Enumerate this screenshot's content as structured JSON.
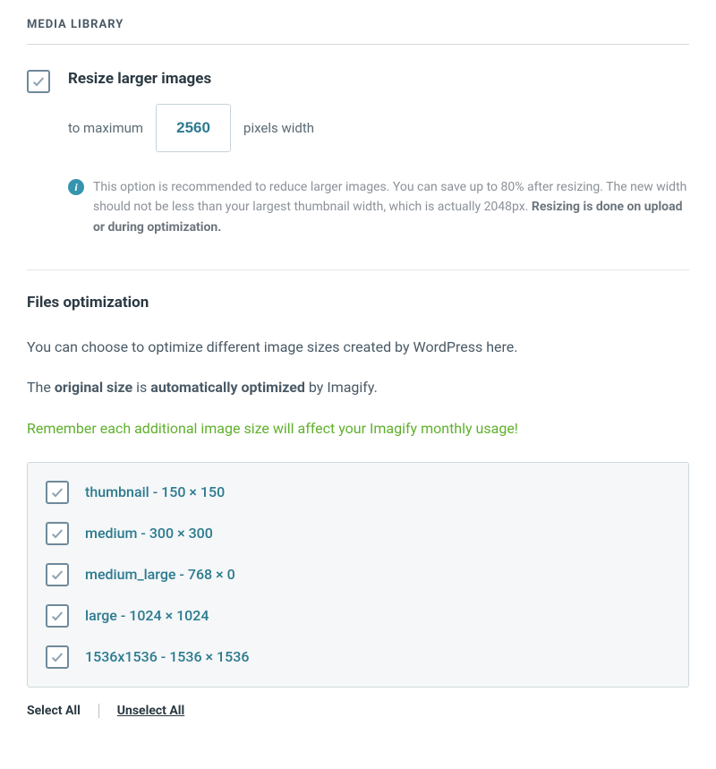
{
  "header": {
    "title": "MEDIA LIBRARY"
  },
  "resize": {
    "title": "Resize larger images",
    "prefix": "to maximum",
    "value": "2560",
    "suffix": "pixels width",
    "info_text_1": "This option is recommended to reduce larger images. You can save up to 80% after resizing. The new width should not be less than your largest thumbnail width, which is actually 2048px. ",
    "info_text_bold": "Resizing is done on upload or during optimization."
  },
  "files_optimization": {
    "title": "Files optimization",
    "line1": "You can choose to optimize different image sizes created by WordPress here.",
    "line2_a": "The ",
    "line2_b": "original size",
    "line2_c": " is ",
    "line2_d": "automatically optimized",
    "line2_e": " by Imagify.",
    "warning": "Remember each additional image size will affect your Imagify monthly usage!",
    "sizes": [
      {
        "label": "thumbnail - 150 × 150"
      },
      {
        "label": "medium - 300 × 300"
      },
      {
        "label": "medium_large - 768 × 0"
      },
      {
        "label": "large - 1024 × 1024"
      },
      {
        "label": "1536x1536 - 1536 × 1536"
      }
    ],
    "select_all": "Select All",
    "unselect_all": "Unselect All"
  }
}
